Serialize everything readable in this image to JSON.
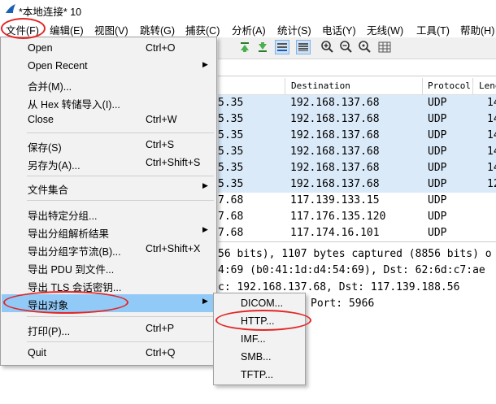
{
  "window": {
    "title": "*本地连接* 10"
  },
  "menubar": [
    "文件(F)",
    "编辑(E)",
    "视图(V)",
    "跳转(G)",
    "捕获(C)",
    "分析(A)",
    "统计(S)",
    "电话(Y)",
    "无线(W)",
    "工具(T)",
    "帮助(H)"
  ],
  "toolbar": {
    "icons": [
      "go-first-icon",
      "go-last-icon",
      "autoscroll-icon",
      "colorize-icon",
      "zoom-in-icon",
      "zoom-out-icon",
      "zoom-reset-icon",
      "resize-columns-icon"
    ]
  },
  "packet_list": {
    "headers": {
      "destination": "Destination",
      "protocol": "Protocol",
      "length": "Leng"
    },
    "rows": [
      {
        "src": "5.35",
        "dst": "192.168.137.68",
        "proto": "UDP",
        "len": "14"
      },
      {
        "src": "5.35",
        "dst": "192.168.137.68",
        "proto": "UDP",
        "len": "14"
      },
      {
        "src": "5.35",
        "dst": "192.168.137.68",
        "proto": "UDP",
        "len": "14"
      },
      {
        "src": "5.35",
        "dst": "192.168.137.68",
        "proto": "UDP",
        "len": "14"
      },
      {
        "src": "5.35",
        "dst": "192.168.137.68",
        "proto": "UDP",
        "len": "14"
      },
      {
        "src": "5.35",
        "dst": "192.168.137.68",
        "proto": "UDP",
        "len": "12"
      },
      {
        "src": "7.68",
        "dst": "117.139.133.15",
        "proto": "UDP",
        "len": ""
      },
      {
        "src": "7.68",
        "dst": "117.176.135.120",
        "proto": "UDP",
        "len": ""
      },
      {
        "src": "7.68",
        "dst": "117.174.16.101",
        "proto": "UDP",
        "len": ""
      }
    ]
  },
  "details": [
    "56 bits), 1107 bytes captured (8856 bits) o",
    "4:69 (b0:41:1d:d4:54:69), Dst: 62:6d:c7:ae",
    "c: 192.168.137.68, Dst: 117.139.188.56",
    "Port: 5966"
  ],
  "file_menu": {
    "items": [
      {
        "label": "Open",
        "accel": "Ctrl+O"
      },
      {
        "label": "Open Recent",
        "submenu": true
      },
      {
        "label": "合并(M)..."
      },
      {
        "label": "从 Hex 转储导入(I)..."
      },
      {
        "label": "Close",
        "accel": "Ctrl+W"
      },
      {
        "label": "保存(S)",
        "accel": "Ctrl+S"
      },
      {
        "label": "另存为(A)...",
        "accel": "Ctrl+Shift+S"
      },
      {
        "label": "文件集合",
        "submenu": true
      },
      {
        "label": "导出特定分组..."
      },
      {
        "label": "导出分组解析结果",
        "submenu": true
      },
      {
        "label": "导出分组字节流(B)...",
        "accel": "Ctrl+Shift+X"
      },
      {
        "label": "导出 PDU 到文件..."
      },
      {
        "label": "导出 TLS 会话密钥..."
      },
      {
        "label": "导出对象",
        "submenu": true
      },
      {
        "label": "打印(P)...",
        "accel": "Ctrl+P"
      },
      {
        "label": "Quit",
        "accel": "Ctrl+Q"
      }
    ]
  },
  "export_objects_submenu": [
    "DICOM...",
    "HTTP...",
    "IMF...",
    "SMB...",
    "TFTP..."
  ],
  "colors": {
    "highlight_row": "#dbeaf9",
    "menu_hover": "#91c9f7",
    "annotation_ring": "#e32626"
  }
}
